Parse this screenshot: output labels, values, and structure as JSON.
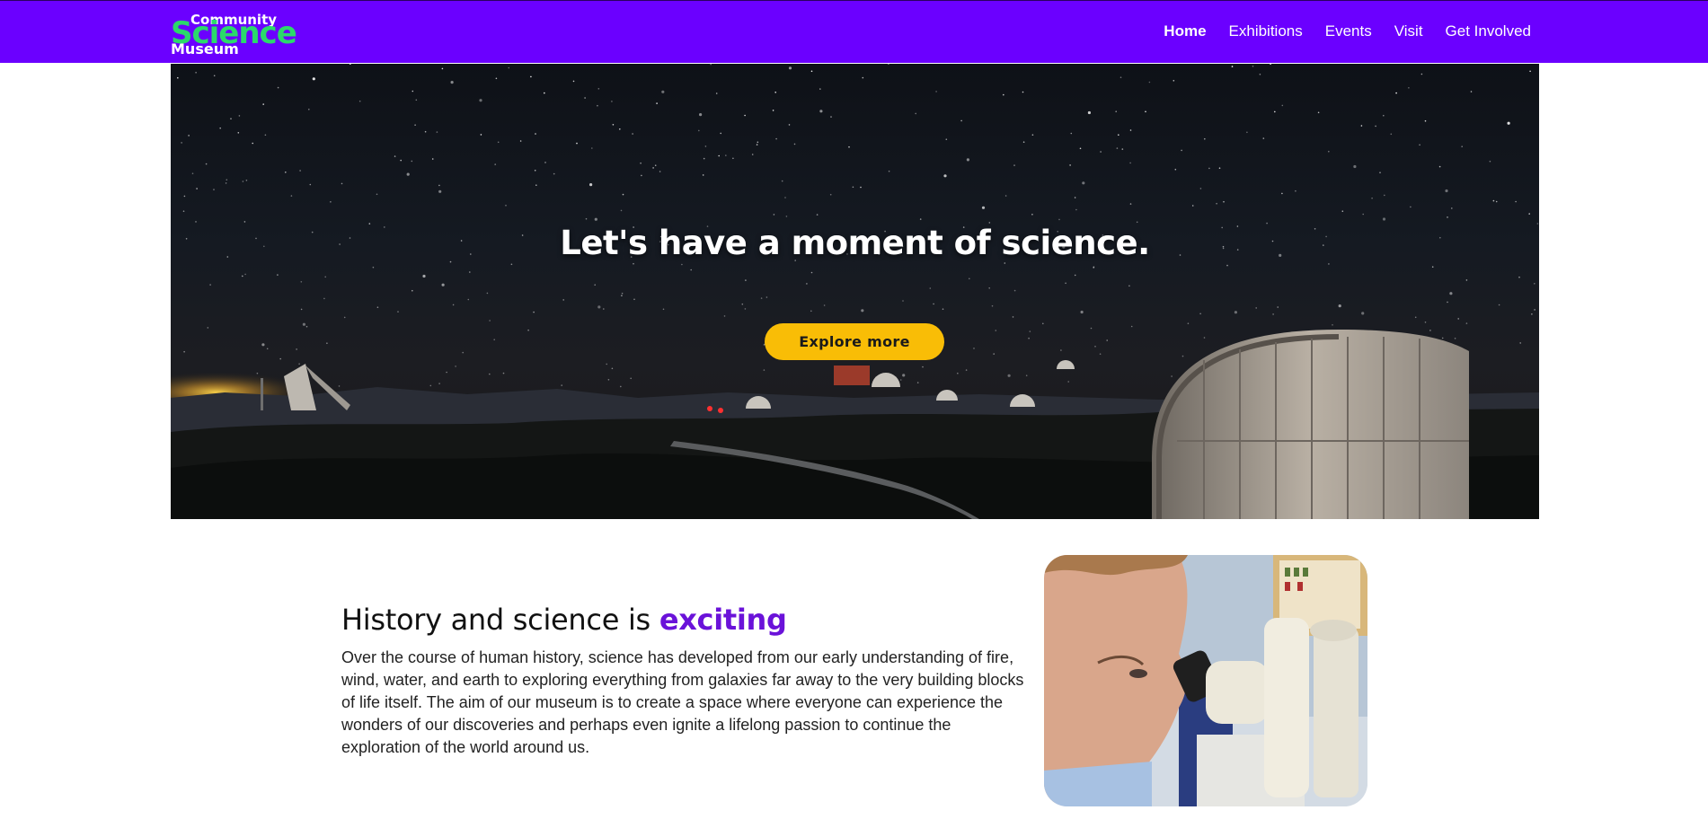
{
  "nav": {
    "logo": {
      "line1": "Community",
      "line2": "Science",
      "line3": "Museum"
    },
    "links": [
      {
        "label": "Home",
        "active": true
      },
      {
        "label": "Exhibitions",
        "active": false
      },
      {
        "label": "Events",
        "active": false
      },
      {
        "label": "Visit",
        "active": false
      },
      {
        "label": "Get Involved",
        "active": false
      }
    ]
  },
  "hero": {
    "title": "Let's have a moment of science.",
    "button_label": "Explore more"
  },
  "about": {
    "heading_prefix": "History and science is ",
    "heading_accent": "exciting",
    "body": "Over the course of human history, science has developed from our early understanding of fire, wind, water, and earth to exploring everything from galaxies far away to the very building blocks of life itself. The aim of our museum is to create a space where everyone can experience the wonders of our discoveries and perhaps even ignite a lifelong passion to continue the exploration of the world around us."
  },
  "colors": {
    "nav_bg": "#6b00ff",
    "logo_green": "#2bd96b",
    "button_yellow": "#f9bd06",
    "accent_purple": "#6a12d9"
  }
}
